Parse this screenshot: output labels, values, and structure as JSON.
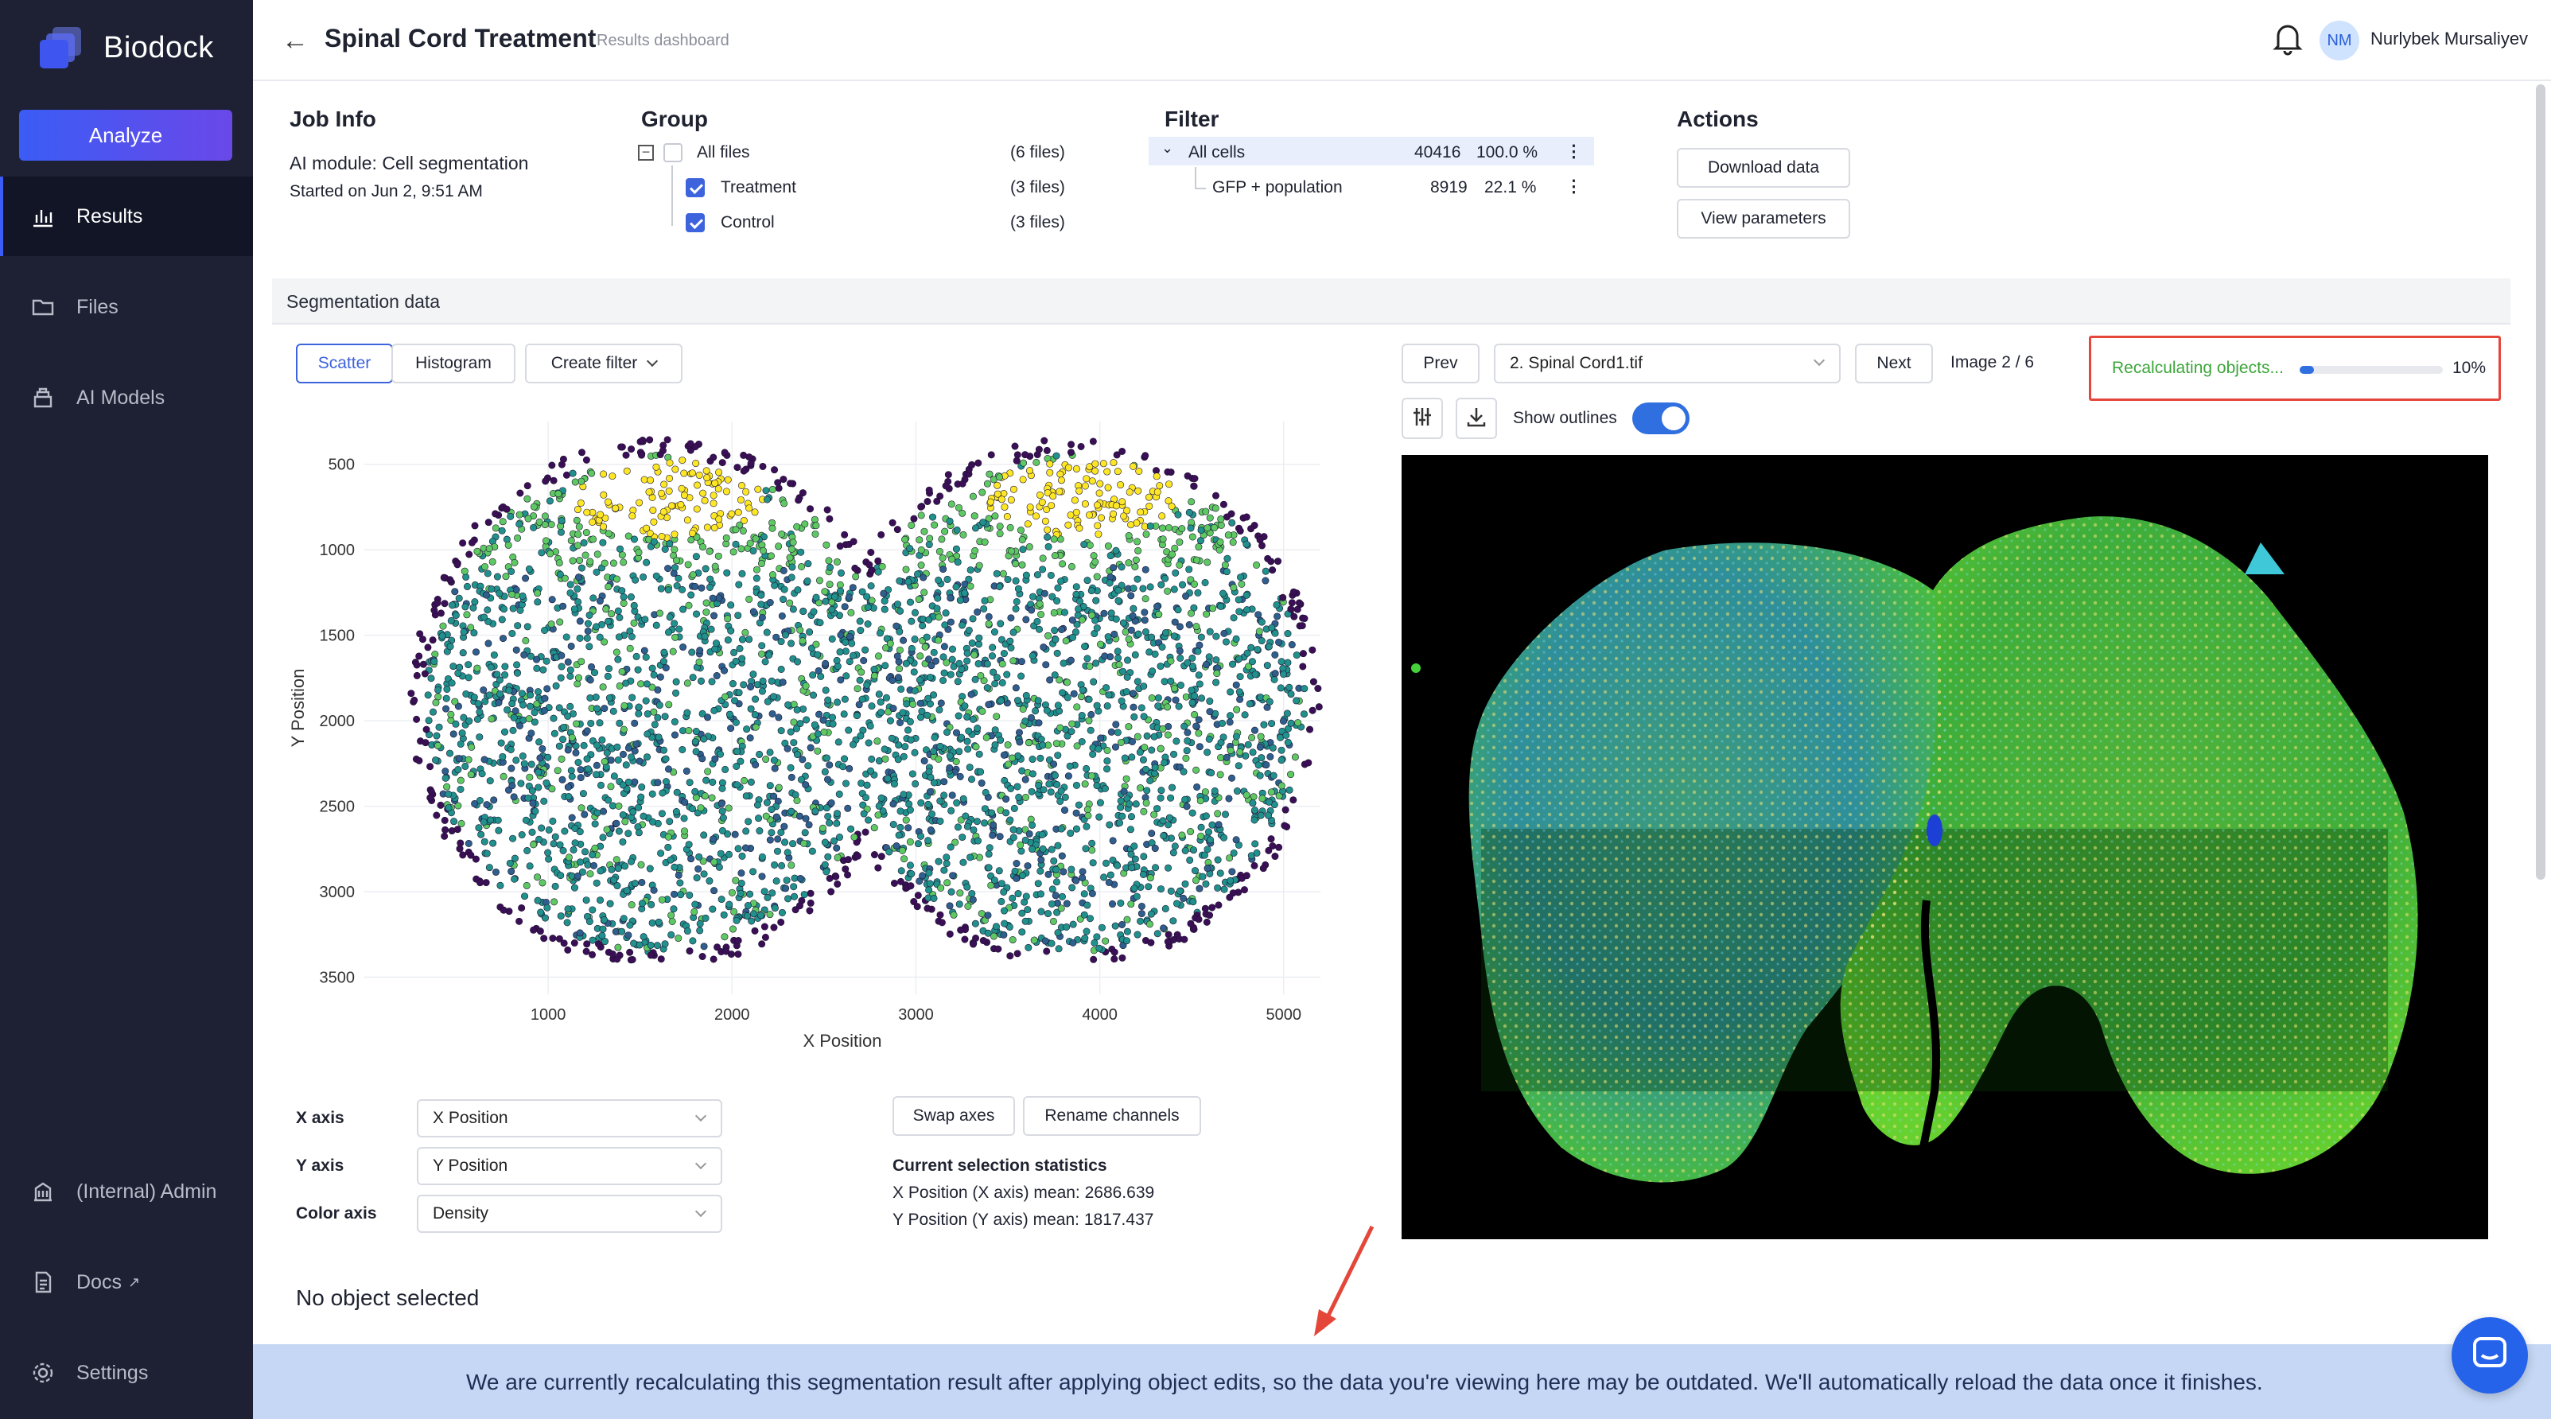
{
  "sidebar": {
    "brand": "Biodock",
    "analyze_label": "Analyze",
    "items": [
      {
        "label": "Results",
        "icon": "bar-chart-icon",
        "active": true
      },
      {
        "label": "Files",
        "icon": "folder-icon"
      },
      {
        "label": "AI Models",
        "icon": "layers-icon"
      }
    ],
    "bottom_items": [
      {
        "label": "(Internal) Admin",
        "icon": "building-icon"
      },
      {
        "label": "Docs",
        "icon": "document-icon"
      },
      {
        "label": "Settings",
        "icon": "gear-icon"
      }
    ]
  },
  "header": {
    "title": "Spinal Cord Treatment",
    "subtitle": "Results dashboard",
    "user_initials": "NM",
    "user_name": "Nurlybek Mursaliyev"
  },
  "job_info": {
    "heading": "Job Info",
    "module": "AI module: Cell segmentation",
    "started": "Started on Jun 2, 9:51 AM"
  },
  "group": {
    "heading": "Group",
    "rows": [
      {
        "label": "All files",
        "count": "(6 files)",
        "checked": false
      },
      {
        "label": "Treatment",
        "count": "(3 files)",
        "checked": true
      },
      {
        "label": "Control",
        "count": "(3 files)",
        "checked": true
      }
    ]
  },
  "filter": {
    "heading": "Filter",
    "rows": [
      {
        "label": "All cells",
        "count": "40416",
        "pct": "100.0 %"
      },
      {
        "label": "GFP + population",
        "count": "8919",
        "pct": "22.1 %"
      }
    ]
  },
  "actions": {
    "heading": "Actions",
    "download": "Download data",
    "view_params": "View parameters"
  },
  "segmentation": {
    "title": "Segmentation data",
    "tabs": {
      "scatter": "Scatter",
      "histogram": "Histogram"
    },
    "create_filter": "Create filter",
    "prev": "Prev",
    "file_select": "2. Spinal Cord1.tif",
    "next": "Next",
    "image_counter": "Image 2 / 6",
    "recalc_label": "Recalculating objects...",
    "recalc_percent": "10%",
    "recalc_progress": 0.1,
    "show_outlines": "Show outlines",
    "outlines_on": true
  },
  "chart_data": {
    "type": "scatter",
    "xlabel": "X Position",
    "ylabel": "Y Position",
    "x_ticks": [
      "1000",
      "2000",
      "3000",
      "4000",
      "5000"
    ],
    "y_ticks": [
      "500",
      "1000",
      "1500",
      "2000",
      "2500",
      "3000",
      "3500"
    ],
    "xlim": [
      0,
      5200
    ],
    "ylim": [
      250,
      3600
    ],
    "y_inverted": true,
    "color_axis": "Density",
    "colormap": [
      "#3b0f56",
      "#2f5f8c",
      "#21918c",
      "#5ec962",
      "#fde725"
    ]
  },
  "axis_controls": {
    "x_label": "X axis",
    "x_value": "X Position",
    "y_label": "Y axis",
    "y_value": "Y Position",
    "color_label": "Color axis",
    "color_value": "Density",
    "swap": "Swap axes",
    "rename": "Rename channels"
  },
  "stats": {
    "heading": "Current selection statistics",
    "x_mean": "X Position (X axis) mean: 2686.639",
    "y_mean": "Y Position (Y axis) mean: 1817.437"
  },
  "no_object": "No object selected",
  "banner": "We are currently recalculating this segmentation result after applying object edits, so the data you're viewing here may be outdated. We'll automatically reload the data once it finishes."
}
